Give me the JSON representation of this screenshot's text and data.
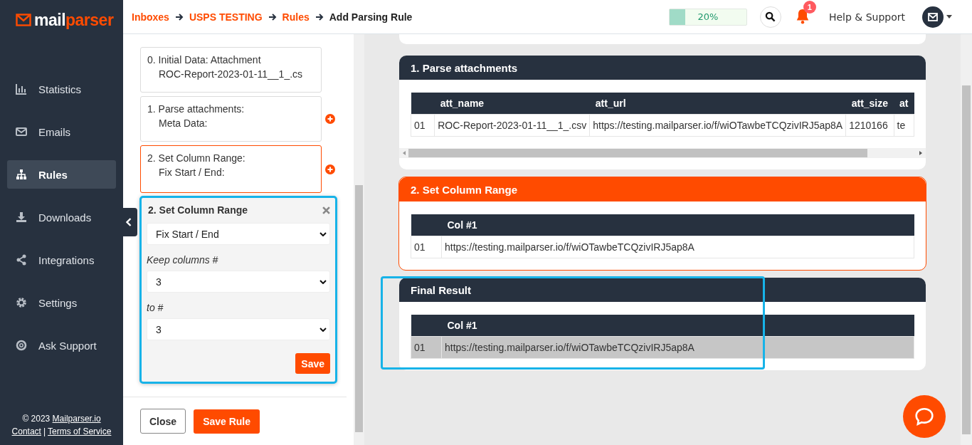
{
  "logo": {
    "parts": [
      "mail",
      "parser"
    ]
  },
  "sidebar": {
    "items": [
      {
        "label": "Statistics",
        "selected": false
      },
      {
        "label": "Emails",
        "selected": false
      },
      {
        "label": "Rules",
        "selected": true
      },
      {
        "label": "Downloads",
        "selected": false
      },
      {
        "label": "Integrations",
        "selected": false
      },
      {
        "label": "Settings",
        "selected": false
      },
      {
        "label": "Ask Support",
        "selected": false
      }
    ],
    "footer": {
      "copyright": "© 2023",
      "site_link": "Mailparser.io",
      "links": [
        "Contact",
        "Terms of Service"
      ],
      "separator": "|"
    }
  },
  "breadcrumbs": [
    {
      "label": "Inboxes",
      "current": false
    },
    {
      "label": "USPS TESTING",
      "current": false
    },
    {
      "label": "Rules",
      "current": false
    },
    {
      "label": "Add Parsing Rule",
      "current": true
    }
  ],
  "progress": {
    "level": 0.2,
    "label": "20%"
  },
  "notifications": {
    "count": "1"
  },
  "help": "Help & Support",
  "steps": [
    {
      "title": "0. Initial Data: Attachment",
      "subtitle": "ROC-Report-2023-01-11__1_.cs",
      "selected": false,
      "can_add": false
    },
    {
      "title": "1. Parse attachments:",
      "subtitle": "Meta Data:",
      "selected": false,
      "can_add": true
    },
    {
      "title": "2. Set Column Range:",
      "subtitle": "Fix Start / End:",
      "selected": true,
      "can_add": true
    }
  ],
  "editor": {
    "title": "2. Set Column Range",
    "highlighted": true,
    "mode": "Fix Start / End",
    "fields": [
      {
        "label": "Keep columns #",
        "value": "3"
      },
      {
        "label": "to #",
        "value": "3"
      }
    ],
    "save": "Save"
  },
  "actions": {
    "close": "Close",
    "save_rule": "Save Rule"
  },
  "results": [
    {
      "title": "1. Parse attachments",
      "selected": false,
      "highlighted": false,
      "scrollbar": true,
      "columns": [
        "",
        "att_name",
        "att_url",
        "att_size",
        "at"
      ],
      "rows": [
        {
          "selected": false,
          "cells": [
            "01",
            "ROC-Report-2023-01-11__1_.csv",
            "https://testing.mailparser.io/f/wiOTawbeTCQzivIRJ5ap8A",
            "1210166",
            "te"
          ]
        }
      ]
    },
    {
      "title": "2. Set Column Range",
      "selected": true,
      "highlighted": false,
      "scrollbar": false,
      "columns": [
        "",
        "Col #1"
      ],
      "rows": [
        {
          "selected": false,
          "cells": [
            "01",
            "https://testing.mailparser.io/f/wiOTawbeTCQzivIRJ5ap8A"
          ]
        }
      ]
    },
    {
      "title": "Final Result",
      "selected": false,
      "highlighted": true,
      "scrollbar": false,
      "columns": [
        "",
        "Col #1"
      ],
      "rows": [
        {
          "selected": true,
          "cells": [
            "01",
            "https://testing.mailparser.io/f/wiOTawbeTCQzivIRJ5ap8A"
          ]
        }
      ]
    }
  ]
}
